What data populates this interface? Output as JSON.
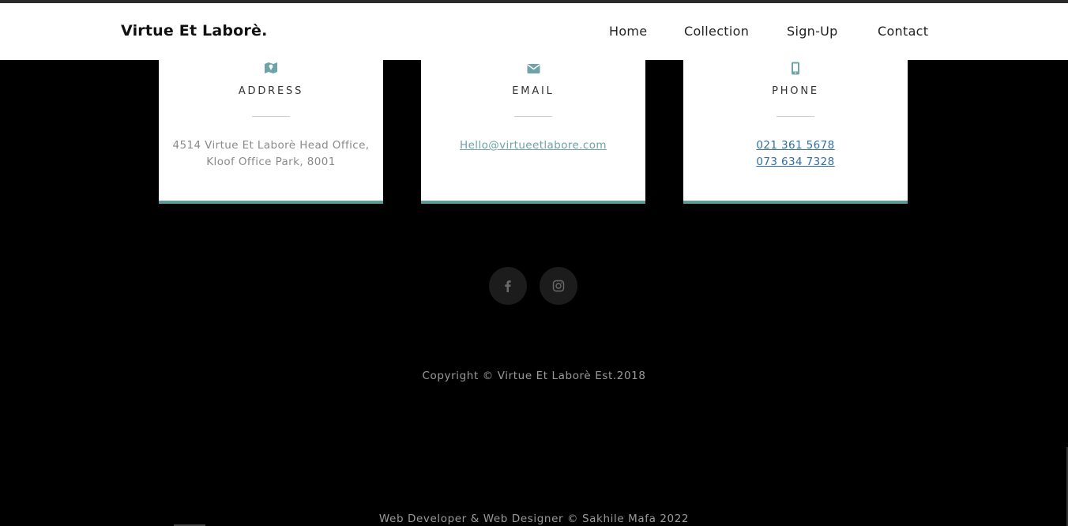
{
  "header": {
    "brand": "Virtue Et Laborè.",
    "nav": [
      {
        "label": "Home"
      },
      {
        "label": "Collection"
      },
      {
        "label": "Sign-Up"
      },
      {
        "label": "Contact"
      }
    ]
  },
  "contact_cards": {
    "address": {
      "icon": "map-icon",
      "title": "ADDRESS",
      "line1": "4514 Virtue Et Laborè Head Office,",
      "line2": "Kloof Office Park, 8001"
    },
    "email": {
      "icon": "envelope-icon",
      "title": "EMAIL",
      "link": "Hello@virtueetlabore.com"
    },
    "phone": {
      "icon": "mobile-phone-icon",
      "title": "PHONE",
      "numbers": [
        "021 361 5678",
        "073 634 7328"
      ]
    }
  },
  "social": {
    "icons": [
      "facebook-icon",
      "instagram-icon"
    ]
  },
  "footer": {
    "copyright": "Copyright © Virtue Et Laborè Est.2018",
    "credit": "Web Developer & Web Designer © Sakhile Mafa 2022"
  },
  "colors": {
    "accent": "#5f9a98",
    "background": "#000000",
    "link": "#2f6ea5"
  }
}
